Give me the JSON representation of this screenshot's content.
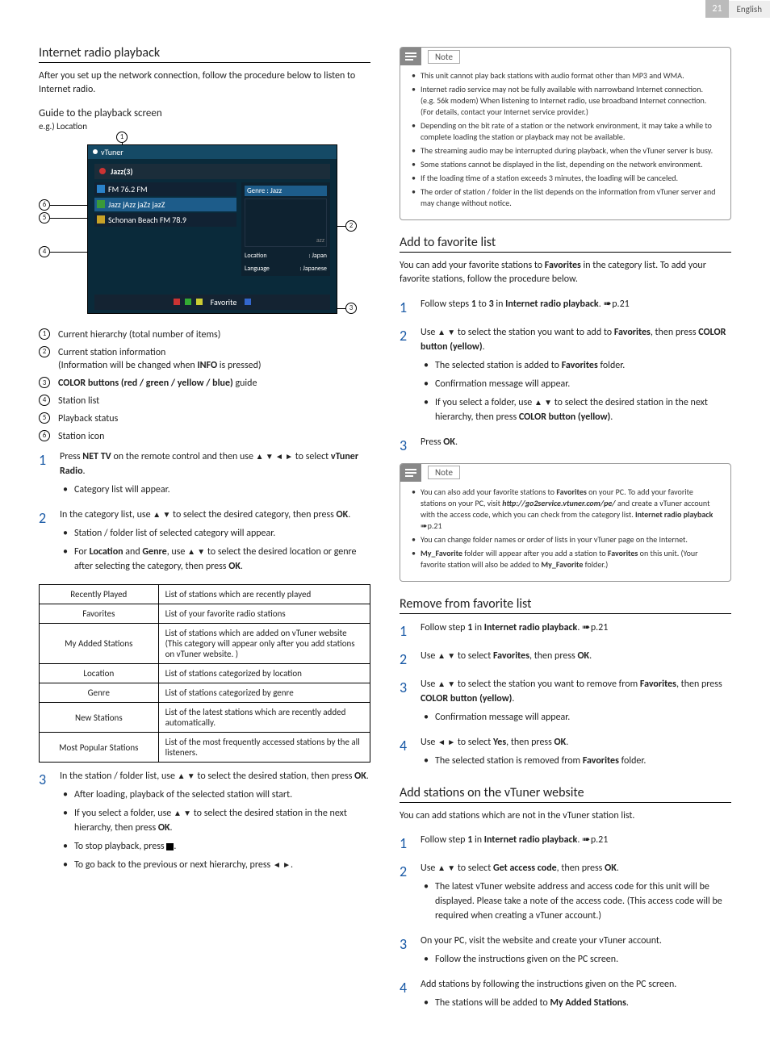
{
  "header": {
    "page_number": "21",
    "language": "English"
  },
  "left": {
    "title": "Internet radio playback",
    "intro": "After you set up the network connection, follow the procedure below to listen to Internet radio.",
    "guide_heading": "Guide to the playback screen",
    "eg": "e.g.) Location",
    "diagram": {
      "callouts": {
        "c1": "1",
        "c2": "2",
        "c3": "3",
        "c4": "4",
        "c5": "5",
        "c6": "6"
      },
      "screen": {
        "top_brand": "vTuner",
        "title_count": "Jazz(3)",
        "rows": [
          {
            "label": "FM 76.2 FM"
          },
          {
            "label": "Jazz jAzz jaZz jazZ"
          },
          {
            "label": "Schonan Beach FM 78.9"
          }
        ],
        "info": {
          "genre_label": "Genre",
          "genre_val": ": Jazz",
          "search_hint": "azz",
          "loc_label": "Location",
          "loc_val": ": Japan",
          "lang_label": "Language",
          "lang_val": ": Japanese"
        },
        "bottom_label": "Favorite"
      }
    },
    "legend": [
      {
        "n": "1",
        "text": "Current hierarchy (total number of items)"
      },
      {
        "n": "2",
        "text_a": "Current station information",
        "text_b_pre": "(Information will be changed when ",
        "text_b_bold": "INFO",
        "text_b_post": " is pressed)"
      },
      {
        "n": "3",
        "bold": "COLOR buttons (red / green / yellow / blue)",
        "text": " guide"
      },
      {
        "n": "4",
        "text": "Station list"
      },
      {
        "n": "5",
        "text": "Playback status"
      },
      {
        "n": "6",
        "text": "Station icon"
      }
    ],
    "steps": [
      {
        "n": "1",
        "run": [
          {
            "t": "Press "
          },
          {
            "b": "NET TV"
          },
          {
            "t": " on the remote control and then use "
          },
          {
            "sym": "▲ ▼ ◄ ►"
          },
          {
            "t": " to select "
          },
          {
            "b": "vTuner Radio"
          },
          {
            "t": "."
          }
        ],
        "subs": [
          {
            "t": "Category list will appear."
          }
        ]
      },
      {
        "n": "2",
        "run": [
          {
            "t": "In the category list, use "
          },
          {
            "sym": "▲ ▼"
          },
          {
            "t": " to select the desired category, then press "
          },
          {
            "b": "OK"
          },
          {
            "t": "."
          }
        ],
        "subs": [
          {
            "t": "Station / folder list of selected category will appear."
          },
          {
            "run": [
              {
                "t": "For "
              },
              {
                "b": "Location"
              },
              {
                "t": " and "
              },
              {
                "b": "Genre"
              },
              {
                "t": ", use "
              },
              {
                "sym": "▲ ▼"
              },
              {
                "t": " to select the desired location or genre after selecting the category, then press "
              },
              {
                "b": "OK"
              },
              {
                "t": "."
              }
            ]
          }
        ]
      }
    ],
    "table": [
      {
        "name": "Recently Played",
        "desc": "List of stations which are recently played"
      },
      {
        "name": "Favorites",
        "desc": "List of your favorite radio stations"
      },
      {
        "name": "My Added Stations",
        "desc": "List of stations which are added on vTuner website (This category will appear only after you add stations on vTuner website. )"
      },
      {
        "name": "Location",
        "desc": "List of stations categorized by location"
      },
      {
        "name": "Genre",
        "desc": "List of stations categorized by genre"
      },
      {
        "name": "New Stations",
        "desc": "List of the latest stations which are recently added automatically."
      },
      {
        "name": "Most Popular Stations",
        "desc": "List of the most frequently accessed stations by the all listeners."
      }
    ],
    "step3": {
      "n": "3",
      "run": [
        {
          "t": "In the station / folder list, use "
        },
        {
          "sym": "▲ ▼"
        },
        {
          "t": " to select the desired station, then press "
        },
        {
          "b": "OK"
        },
        {
          "t": "."
        }
      ],
      "subs": [
        {
          "t": "After loading, playback of the selected station will start."
        },
        {
          "run": [
            {
              "t": "If you select a folder, use "
            },
            {
              "sym": "▲ ▼"
            },
            {
              "t": " to select the desired station in the next hierarchy, then press "
            },
            {
              "b": "OK"
            },
            {
              "t": "."
            }
          ]
        },
        {
          "run": [
            {
              "t": "To stop playback, press "
            },
            {
              "stop": true
            },
            {
              "t": "."
            }
          ]
        },
        {
          "run": [
            {
              "t": "To go back to the previous or next hierarchy, press "
            },
            {
              "sym": "◄ ►"
            },
            {
              "t": "."
            }
          ]
        }
      ]
    }
  },
  "right": {
    "note1": {
      "label": "Note",
      "items": [
        "This unit cannot play back stations with audio format other than MP3 and WMA.",
        "Internet radio service may not be fully available with narrowband Internet connection. (e.g. 56k modem) When listening to Internet radio, use broadband Internet connection. (For details, contact your Internet service provider.)",
        "Depending on the bit rate of a station or the network environment, it may take a while to complete loading the station or playback may not be available.",
        "The streaming audio may be interrupted during playback, when the vTuner server is busy.",
        "Some stations cannot be displayed in the list, depending on the network environment.",
        "If the loading time of a station exceeds 3 minutes, the loading will be canceled.",
        "The order of station / folder in the list depends on the information from vTuner server and may change without notice."
      ]
    },
    "fav": {
      "title": "Add to favorite list",
      "intro_a": "You can add your favorite stations to ",
      "intro_b": "Favorites",
      "intro_c": " in the category list. To add your favorite stations, follow the procedure below.",
      "steps": [
        {
          "n": "1",
          "run": [
            {
              "t": "Follow steps "
            },
            {
              "b": "1"
            },
            {
              "t": " to "
            },
            {
              "b": "3"
            },
            {
              "t": " in "
            },
            {
              "b": "Internet radio playback"
            },
            {
              "t": ". "
            },
            {
              "pg": "p.21"
            }
          ]
        },
        {
          "n": "2",
          "run": [
            {
              "t": "Use "
            },
            {
              "sym": "▲ ▼"
            },
            {
              "t": " to select the station you want to add to "
            },
            {
              "b": "Favorites"
            },
            {
              "t": ", then press "
            },
            {
              "b": "COLOR button (yellow)"
            },
            {
              "t": "."
            }
          ],
          "subs": [
            {
              "run": [
                {
                  "t": "The selected station is added to "
                },
                {
                  "b": "Favorites"
                },
                {
                  "t": " folder."
                }
              ]
            },
            {
              "t": "Confirmation message will appear."
            },
            {
              "run": [
                {
                  "t": "If you select a folder, use "
                },
                {
                  "sym": "▲ ▼"
                },
                {
                  "t": " to select the desired station in the next hierarchy, then press "
                },
                {
                  "b": "COLOR button (yellow)"
                },
                {
                  "t": "."
                }
              ]
            }
          ]
        },
        {
          "n": "3",
          "run": [
            {
              "t": "Press "
            },
            {
              "b": "OK"
            },
            {
              "t": "."
            }
          ]
        }
      ],
      "note": {
        "label": "Note",
        "items": [
          {
            "run": [
              {
                "t": "You can also add your favorite stations to "
              },
              {
                "b": "Favorites"
              },
              {
                "t": " on your PC. To add your favorite stations on your PC, visit "
              },
              {
                "bi": "http://go2service.vtuner.com/pe/"
              },
              {
                "t": " and create a vTuner account with the access code, which you can check from the category list. "
              },
              {
                "b": "Internet radio playback"
              },
              {
                "t": " "
              },
              {
                "pg": "p.21"
              }
            ]
          },
          {
            "t": "You can change folder names or order of lists in your vTuner page on the Internet."
          },
          {
            "run": [
              {
                "b": "My_Favorite"
              },
              {
                "t": " folder will appear after you add a station to "
              },
              {
                "b": "Favorites"
              },
              {
                "t": " on this unit. (Your favorite station will also be added to "
              },
              {
                "b": "My_Favorite"
              },
              {
                "t": " folder.)"
              }
            ]
          }
        ]
      }
    },
    "remove": {
      "title": "Remove from favorite list",
      "steps": [
        {
          "n": "1",
          "run": [
            {
              "t": "Follow step "
            },
            {
              "b": "1"
            },
            {
              "t": " in "
            },
            {
              "b": "Internet radio playback"
            },
            {
              "t": ". "
            },
            {
              "pg": "p.21"
            }
          ]
        },
        {
          "n": "2",
          "run": [
            {
              "t": "Use "
            },
            {
              "sym": "▲ ▼"
            },
            {
              "t": " to select "
            },
            {
              "b": "Favorites"
            },
            {
              "t": ", then press "
            },
            {
              "b": "OK"
            },
            {
              "t": "."
            }
          ]
        },
        {
          "n": "3",
          "run": [
            {
              "t": "Use "
            },
            {
              "sym": "▲ ▼"
            },
            {
              "t": " to select the station you want to remove from "
            },
            {
              "b": "Favorites"
            },
            {
              "t": ", then press "
            },
            {
              "b": "COLOR button (yellow)"
            },
            {
              "t": "."
            }
          ],
          "subs": [
            {
              "t": "Confirmation message will appear."
            }
          ]
        },
        {
          "n": "4",
          "run": [
            {
              "t": "Use "
            },
            {
              "sym": "◄ ►"
            },
            {
              "t": " to select "
            },
            {
              "b": "Yes"
            },
            {
              "t": ", then press "
            },
            {
              "b": "OK"
            },
            {
              "t": "."
            }
          ],
          "subs": [
            {
              "run": [
                {
                  "t": "The selected station is removed from "
                },
                {
                  "b": "Favorites"
                },
                {
                  "t": " folder."
                }
              ]
            }
          ]
        }
      ]
    },
    "addweb": {
      "title": "Add stations on the vTuner website",
      "intro": "You can add stations which are not in the vTuner station list.",
      "steps": [
        {
          "n": "1",
          "run": [
            {
              "t": "Follow step "
            },
            {
              "b": "1"
            },
            {
              "t": " in "
            },
            {
              "b": "Internet radio playback"
            },
            {
              "t": ". "
            },
            {
              "pg": "p.21"
            }
          ]
        },
        {
          "n": "2",
          "run": [
            {
              "t": "Use "
            },
            {
              "sym": "▲ ▼"
            },
            {
              "t": " to select "
            },
            {
              "b": "Get access code"
            },
            {
              "t": ", then press "
            },
            {
              "b": "OK"
            },
            {
              "t": "."
            }
          ],
          "subs": [
            {
              "t": "The latest vTuner website address and access code for this unit will be displayed. Please take a note of the access code. (This access code will be required when creating a vTuner account.)"
            }
          ]
        },
        {
          "n": "3",
          "run": [
            {
              "t": "On your PC, visit the website and create your vTuner account."
            }
          ],
          "subs": [
            {
              "t": "Follow the instructions given on the PC screen."
            }
          ]
        },
        {
          "n": "4",
          "run": [
            {
              "t": "Add stations by following the instructions given on the PC screen."
            }
          ],
          "subs": [
            {
              "run": [
                {
                  "t": "The stations will be added to "
                },
                {
                  "b": "My Added Stations"
                },
                {
                  "t": "."
                }
              ]
            }
          ]
        }
      ]
    }
  }
}
